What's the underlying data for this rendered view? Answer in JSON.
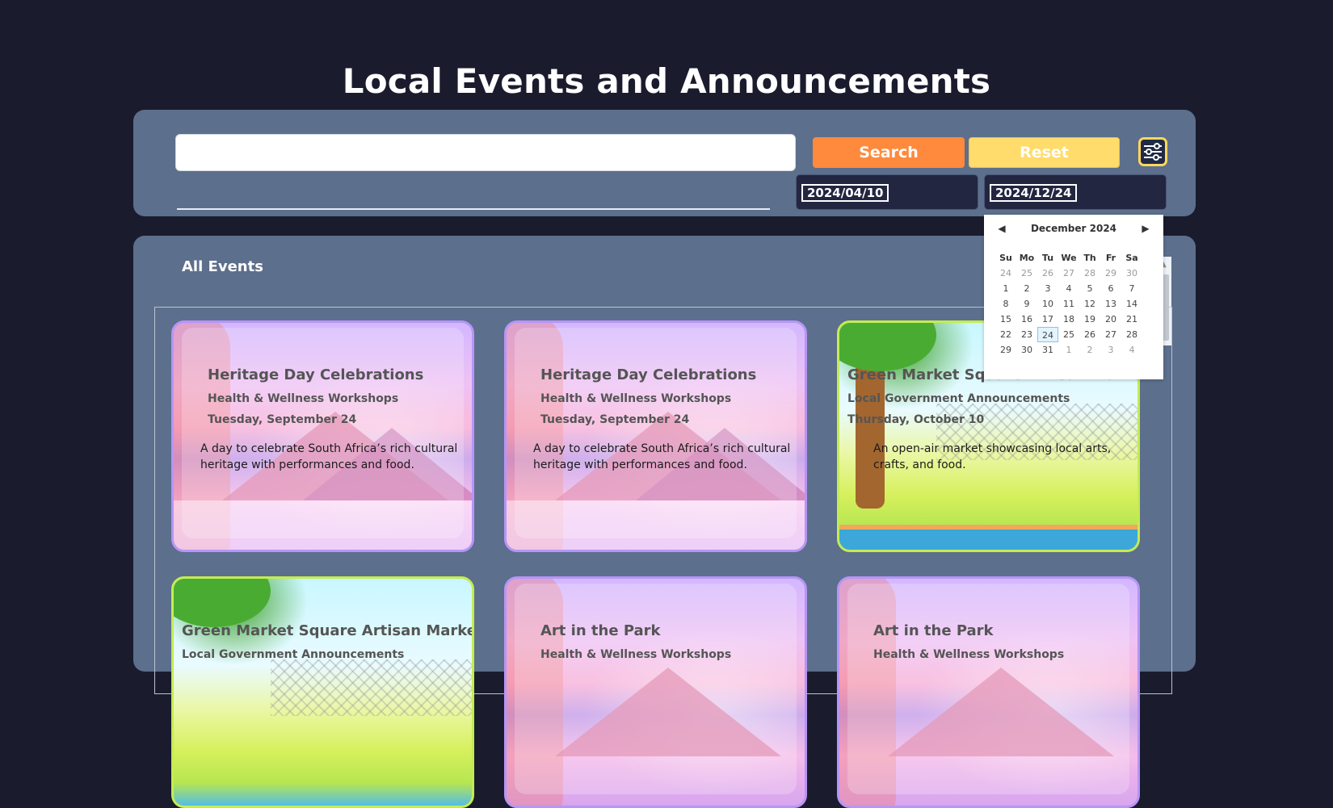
{
  "page": {
    "title": "Local Events and Announcements"
  },
  "search": {
    "value": "",
    "placeholder": "",
    "search_label": "Search",
    "reset_label": "Reset",
    "start_date": "2024/04/10",
    "end_date": "2024/12/24"
  },
  "icons": {
    "filter": "sliders-icon",
    "prev": "triangle-left-icon",
    "next": "triangle-right-icon"
  },
  "colors": {
    "search": "#ff8a3d",
    "reset": "#ffdc6b",
    "panel": "#5c6f8c",
    "background": "#1a1c2e"
  },
  "events": {
    "section_title": "All Events",
    "cards": [
      {
        "title": "Heritage Day Celebrations",
        "category": "Health & Wellness Workshops",
        "date": "Tuesday, September 24",
        "description": "A day to celebrate South Africa’s rich cultural heritage with performances and food."
      },
      {
        "title": "Heritage Day Celebrations",
        "category": "Health & Wellness Workshops",
        "date": "Tuesday, September 24",
        "description": "A day to celebrate South Africa’s rich cultural heritage with performances and food."
      },
      {
        "title": "Green Market Square Artisan Market",
        "category": "Local Government Announcements",
        "date": "Thursday, October 10",
        "description": "An open-air market showcasing local arts, crafts, and food."
      },
      {
        "title": "Green Market Square Artisan Market",
        "category": "Local Government Announcements",
        "date": "",
        "description": ""
      },
      {
        "title": "Art in the Park",
        "category": "Health & Wellness Workshops",
        "date": "",
        "description": ""
      },
      {
        "title": "Art in the Park",
        "category": "Health & Wellness Workshops",
        "date": "",
        "description": ""
      }
    ]
  },
  "calendar": {
    "month_label": "December 2024",
    "weekdays": [
      "Su",
      "Mo",
      "Tu",
      "We",
      "Th",
      "Fr",
      "Sa"
    ],
    "weeks": [
      [
        "24",
        "25",
        "26",
        "27",
        "28",
        "29",
        "30"
      ],
      [
        "1",
        "2",
        "3",
        "4",
        "5",
        "6",
        "7"
      ],
      [
        "8",
        "9",
        "10",
        "11",
        "12",
        "13",
        "14"
      ],
      [
        "15",
        "16",
        "17",
        "18",
        "19",
        "20",
        "21"
      ],
      [
        "22",
        "23",
        "24",
        "25",
        "26",
        "27",
        "28"
      ],
      [
        "29",
        "30",
        "31",
        "1",
        "2",
        "3",
        "4"
      ]
    ],
    "selected_day": "24"
  }
}
